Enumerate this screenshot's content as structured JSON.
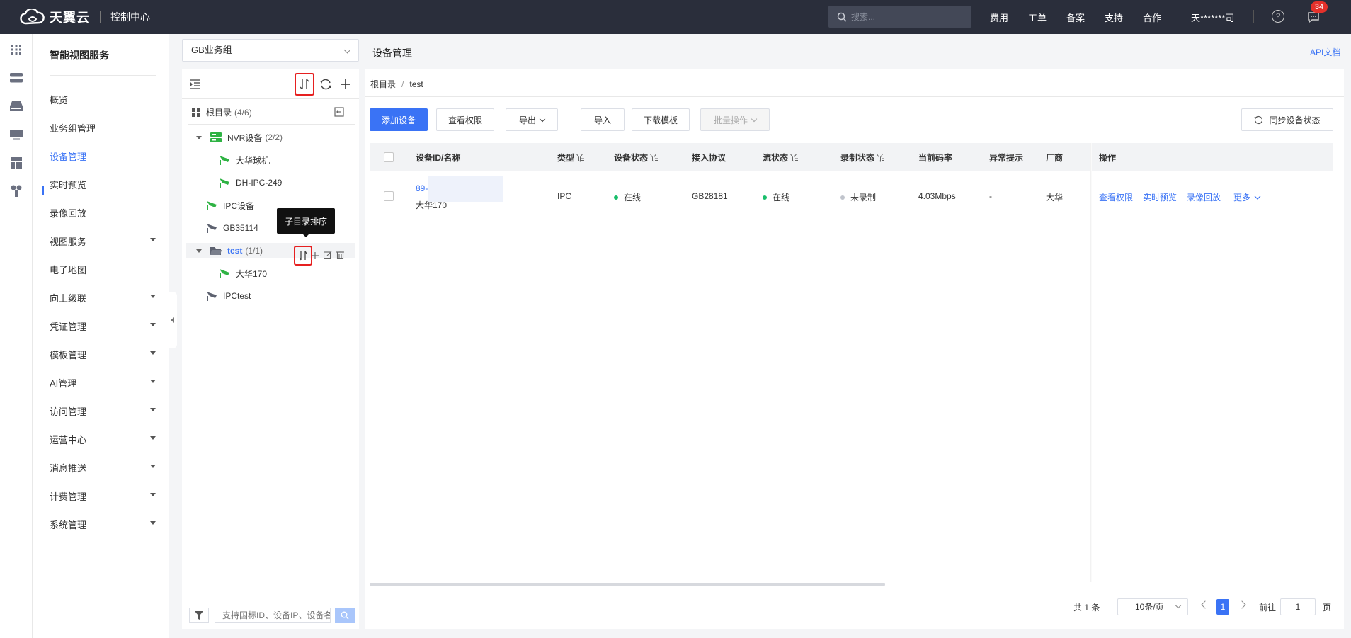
{
  "topbar": {
    "brand": "天翼云",
    "console": "控制中心",
    "search_placeholder": "搜索...",
    "nav": [
      "费用",
      "工单",
      "备案",
      "支持",
      "合作"
    ],
    "user": "天*******司",
    "help": "?",
    "message_badge": "34"
  },
  "rail_icons": [
    "apps-icon",
    "server-icon",
    "storage-icon",
    "monitor-icon",
    "layout-icon",
    "network-icon"
  ],
  "menu": {
    "title": "智能视图服务",
    "items": [
      {
        "label": "概览",
        "expandable": false
      },
      {
        "label": "业务组管理",
        "expandable": false
      },
      {
        "label": "设备管理",
        "expandable": false,
        "active": true
      },
      {
        "label": "实时预览",
        "expandable": false
      },
      {
        "label": "录像回放",
        "expandable": false
      },
      {
        "label": "视图服务",
        "expandable": true
      },
      {
        "label": "电子地图",
        "expandable": false
      },
      {
        "label": "向上级联",
        "expandable": true
      },
      {
        "label": "凭证管理",
        "expandable": true
      },
      {
        "label": "模板管理",
        "expandable": true
      },
      {
        "label": "AI管理",
        "expandable": true
      },
      {
        "label": "访问管理",
        "expandable": true
      },
      {
        "label": "运营中心",
        "expandable": true
      },
      {
        "label": "消息推送",
        "expandable": true
      },
      {
        "label": "计费管理",
        "expandable": true
      },
      {
        "label": "系统管理",
        "expandable": true
      }
    ]
  },
  "tree": {
    "group_select": "GB业务组",
    "root_label": "根目录",
    "root_count": "(4/6)",
    "tooltip": "子目录排序",
    "nodes": [
      {
        "label": "NVR设备",
        "count": "(2/2)"
      },
      {
        "label": "大华球机"
      },
      {
        "label": "DH-IPC-249"
      },
      {
        "label": "IPC设备"
      },
      {
        "label": "GB35114"
      },
      {
        "label": "test",
        "count": "(1/1)"
      },
      {
        "label": "大华170"
      },
      {
        "label": "IPCtest"
      }
    ],
    "search_placeholder": "支持国标ID、设备IP、设备名称搜索"
  },
  "main": {
    "title": "设备管理",
    "api_link": "API文档",
    "breadcrumb": [
      "根目录",
      "test"
    ],
    "buttons": {
      "add": "添加设备",
      "view_perm": "查看权限",
      "export": "导出",
      "import": "导入",
      "download_tpl": "下载模板",
      "batch": "批量操作",
      "sync": "同步设备状态"
    },
    "columns": [
      "设备ID/名称",
      "类型",
      "设备状态",
      "接入协议",
      "流状态",
      "录制状态",
      "当前码率",
      "异常提示",
      "厂商",
      "操作"
    ],
    "rows": [
      {
        "id": "89-",
        "name": "大华170",
        "type": "IPC",
        "device_status": "在线",
        "protocol": "GB28181",
        "stream_status": "在线",
        "record_status": "未录制",
        "bitrate": "4.03Mbps",
        "alert": "-",
        "vendor": "大华",
        "actions": [
          "查看权限",
          "实时预览",
          "录像回放",
          "更多"
        ]
      }
    ]
  },
  "pagination": {
    "total": "共 1 条",
    "page_size": "10条/页",
    "current": "1",
    "goto_label": "前往",
    "goto_value": "1",
    "unit": "页"
  },
  "colors": {
    "primary": "#3a73f5",
    "online": "#19be6b",
    "idle": "#c0c4cc",
    "topbar": "#2a2e3b",
    "highlight": "#e62020"
  }
}
